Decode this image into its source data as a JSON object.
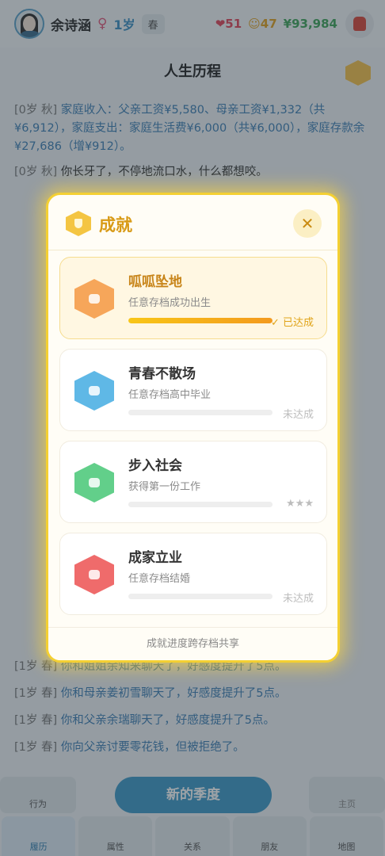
{
  "topbar": {
    "username": "余诗涵",
    "gender": "♀",
    "age": "1岁",
    "season": "春",
    "health": "❤51",
    "mood": "☺47",
    "money": "¥93,984"
  },
  "history": {
    "title": "人生历程",
    "entries": [
      {
        "time": "[0岁 秋]",
        "text": "家庭收入：父亲工资¥5,580、母亲工资¥1,332（共¥6,912），家庭支出：家庭生活费¥6,000（共¥6,000），家庭存款余¥27,686（增¥912）。"
      },
      {
        "time": "[0岁 秋]",
        "text": "你长牙了，不停地流口水，什么都想咬。"
      },
      {
        "time": "[1岁 春]",
        "text": "你和姐姐余知来聊天了，好感度提升了5点。"
      },
      {
        "time": "[1岁 春]",
        "text": "你和母亲姜初雪聊天了，好感度提升了5点。"
      },
      {
        "time": "[1岁 春]",
        "text": "你和父亲余瑞聊天了，好感度提升了5点。"
      },
      {
        "time": "[1岁 春]",
        "text": "你向父亲讨要零花钱，但被拒绝了。"
      }
    ]
  },
  "actions": {
    "action_label": "行为",
    "new_season": "新的季度",
    "home_label": "主页"
  },
  "tabs": [
    "履历",
    "属性",
    "关系",
    "朋友",
    "地图"
  ],
  "modal": {
    "title": "成就",
    "close": "✕",
    "footer": "成就进度跨存档共享",
    "items": [
      {
        "name": "呱呱坠地",
        "desc": "任意存档成功出生",
        "status": "✓ 已达成",
        "progress": 1.0,
        "color": "#f6a65a"
      },
      {
        "name": "青春不散场",
        "desc": "任意存档高中毕业",
        "status": "未达成",
        "progress": 0,
        "color": "#5fb8e6"
      },
      {
        "name": "步入社会",
        "desc": "获得第一份工作",
        "status": "★★★",
        "progress": 0,
        "color": "#62cf8a"
      },
      {
        "name": "成家立业",
        "desc": "任意存档结婚",
        "status": "未达成",
        "progress": 0,
        "color": "#ef6b6b"
      }
    ]
  }
}
